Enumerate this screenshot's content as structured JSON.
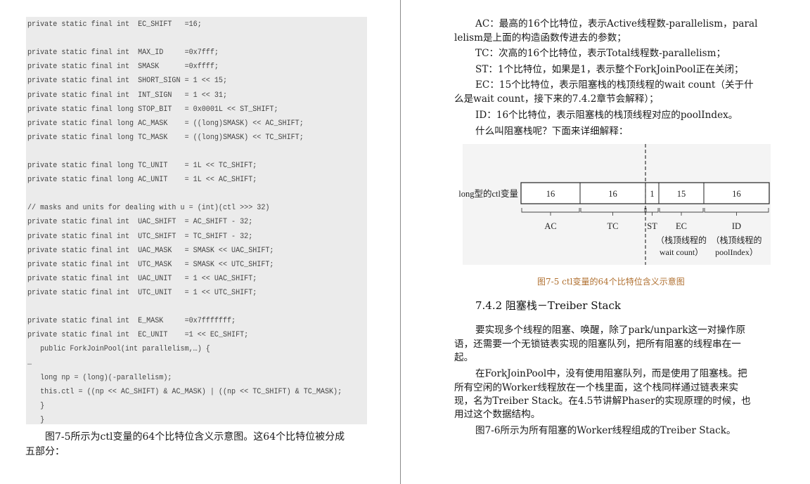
{
  "left_page": {
    "code_lines": [
      "private static final int  EC_SHIFT   =16;",
      "",
      "private static final int  MAX_ID     =0x7fff;",
      "private static final int  SMASK      =0xffff;",
      "private static final int  SHORT_SIGN = 1 << 15;",
      "private static final int  INT_SIGN   = 1 << 31;",
      "private static final long STOP_BIT   = 0x0001L << ST_SHIFT;",
      "private static final long AC_MASK    = ((long)SMASK) << AC_SHIFT;",
      "private static final long TC_MASK    = ((long)SMASK) << TC_SHIFT;",
      "",
      "private static final long TC_UNIT    = 1L << TC_SHIFT;",
      "private static final long AC_UNIT    = 1L << AC_SHIFT;",
      "",
      "// masks and units for dealing with u = (int)(ctl >>> 32)",
      "private static final int  UAC_SHIFT  = AC_SHIFT - 32;",
      "private static final int  UTC_SHIFT  = TC_SHIFT - 32;",
      "private static final int  UAC_MASK   = SMASK << UAC_SHIFT;",
      "private static final int  UTC_MASK   = SMASK << UTC_SHIFT;",
      "private static final int  UAC_UNIT   = 1 << UAC_SHIFT;",
      "private static final int  UTC_UNIT   = 1 << UTC_SHIFT;",
      "",
      "private static final int  E_MASK     =0x7fffffff;",
      "private static final int  EC_UNIT    =1 << EC_SHIFT;",
      "   public ForkJoinPool(int parallelism,…) {",
      "…",
      "   long np = (long)(-parallelism);",
      "   this.ctl = ((np << AC_SHIFT) & AC_MASK) | ((np << TC_SHIFT) & TC_MASK);",
      "   }",
      "   }"
    ],
    "paragraph": "图7-5所示为ctl变量的64个比特位含义示意图。这64个比特位被分成五部分："
  },
  "right_page": {
    "lines": [
      {
        "text": "AC：最高的16个比特位，表示Active线程数-parallelism，paral",
        "indent": true
      },
      {
        "text": "lelism是上面的构造函数传进去的参数；",
        "indent": false
      },
      {
        "text": "TC：次高的16个比特位，表示Total线程数-parallelism；",
        "indent": true
      },
      {
        "text": "ST：1个比特位，如果是1，表示整个ForkJoinPool正在关闭；",
        "indent": true
      },
      {
        "text": "EC：15个比特位，表示阻塞栈的栈顶线程的wait count（关于什",
        "indent": true
      },
      {
        "text": "么是wait count，接下来的7.4.2章节会解释）；",
        "indent": false
      },
      {
        "text": "ID：16个比特位，表示阻塞栈的栈顶线程对应的poolIndex。",
        "indent": true
      },
      {
        "text": "什么叫阻塞栈呢？下面来详细解释：",
        "indent": true
      }
    ],
    "diagram": {
      "variable_label": "long型的ctl变量",
      "fields": [
        {
          "bits": "16",
          "name": "AC",
          "desc": []
        },
        {
          "bits": "16",
          "name": "TC",
          "desc": []
        },
        {
          "bits": "1",
          "name": "ST",
          "desc": []
        },
        {
          "bits": "15",
          "name": "EC",
          "desc": [
            "（栈顶线程的",
            "wait count）"
          ]
        },
        {
          "bits": "16",
          "name": "ID",
          "desc": [
            "（栈顶线程的",
            "poolIndex）"
          ]
        }
      ]
    },
    "caption": "图7-5  ctl变量的64个比特位含义示意图",
    "section_title": "7.4.2 阻塞栈－Treiber Stack",
    "body_lines": [
      {
        "text": "要实现多个线程的阻塞、唤醒，除了park/unpark这一对操作原",
        "indent": true
      },
      {
        "text": "语，还需要一个无锁链表实现的阻塞队列，把所有阻塞的线程串在一",
        "indent": false
      },
      {
        "text": "起。",
        "indent": false
      },
      {
        "text": "在ForkJoinPool中，没有使用阻塞队列，而是使用了阻塞栈。把",
        "indent": true
      },
      {
        "text": "所有空闲的Worker线程放在一个栈里面，这个栈同样通过链表来实",
        "indent": false
      },
      {
        "text": "现，名为Treiber Stack。在4.5节讲解Phaser的实现原理的时候，也",
        "indent": false
      },
      {
        "text": "用过这个数据结构。",
        "indent": false
      },
      {
        "text": "图7-6所示为所有阻塞的Worker线程组成的Treiber Stack。",
        "indent": true
      }
    ]
  }
}
